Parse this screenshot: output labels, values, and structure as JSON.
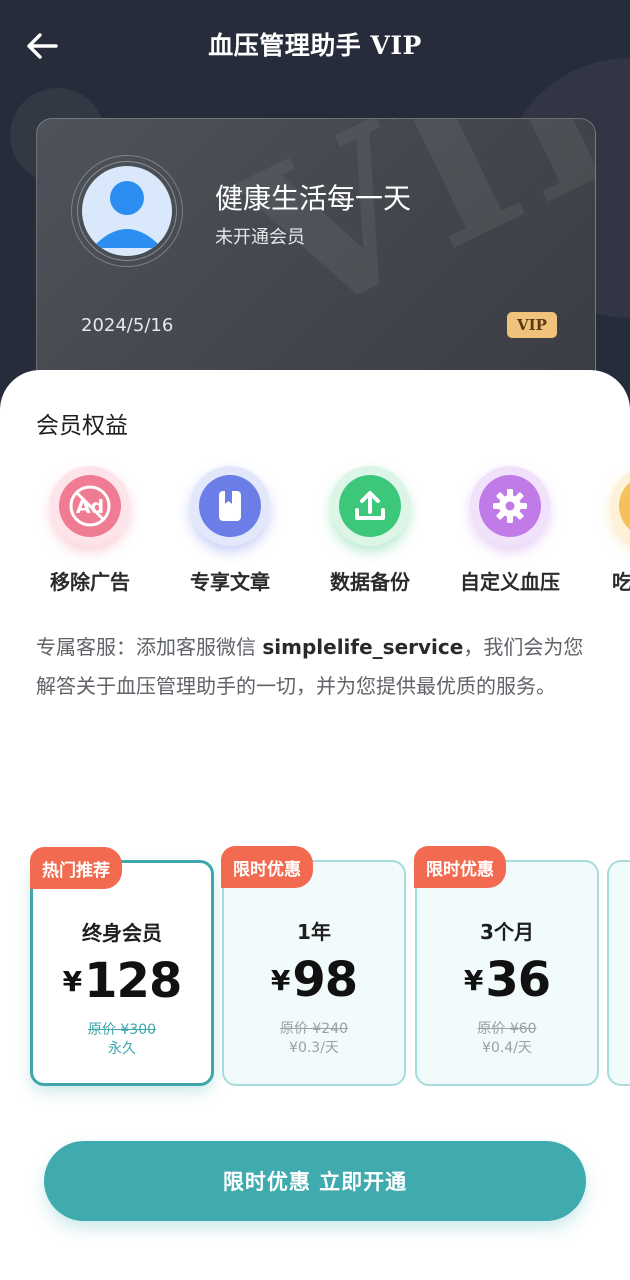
{
  "header": {
    "title": "血压管理助手",
    "title_suffix": "VIP"
  },
  "card": {
    "name": "健康生活每一天",
    "status": "未开通会员",
    "date": "2024/5/16",
    "badge": "VIP",
    "watermark": "VIP"
  },
  "benefits": {
    "title": "会员权益",
    "items": [
      {
        "label": "移除广告",
        "icon": "no-ads-icon",
        "color": "#f07c93"
      },
      {
        "label": "专享文章",
        "icon": "article-icon",
        "color": "#6b7ee8"
      },
      {
        "label": "数据备份",
        "icon": "upload-icon",
        "color": "#3cc77a"
      },
      {
        "label": "自定义血压",
        "icon": "gear-icon",
        "color": "#c07be8"
      },
      {
        "label": "吃",
        "icon": "partial-icon",
        "color": "#f5c15a"
      }
    ]
  },
  "service": {
    "prefix": "专属客服：添加客服微信 ",
    "wechat": "simplelife_service",
    "suffix": "，我们会为您解答关于血压管理助手的一切，并为您提供最优质的服务。"
  },
  "plans": [
    {
      "tag": "热门推荐",
      "name": "终身会员",
      "currency": "¥",
      "price": "128",
      "original": "原价 ¥300",
      "note": "永久",
      "selected": true
    },
    {
      "tag": "限时优惠",
      "name": "1年",
      "currency": "¥",
      "price": "98",
      "original": "原价 ¥240",
      "note": "¥0.3/天",
      "selected": false
    },
    {
      "tag": "限时优惠",
      "name": "3个月",
      "currency": "¥",
      "price": "36",
      "original": "原价 ¥60",
      "note": "¥0.4/天",
      "selected": false
    }
  ],
  "cta": {
    "label": "限时优惠 立即开通"
  },
  "colors": {
    "accent": "#3fabae",
    "tag": "#f26a4f",
    "badge": "#f0c27b",
    "header_bg": "#272c3a"
  }
}
